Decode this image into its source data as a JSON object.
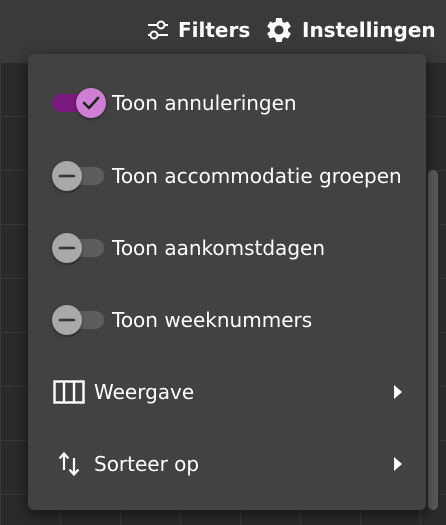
{
  "topbar": {
    "filters_label": "Filters",
    "filters_icon": "sliders-icon",
    "settings_label": "Instellingen",
    "settings_icon": "gear-icon"
  },
  "menu": {
    "toggles": [
      {
        "label": "Toon annuleringen",
        "on": true
      },
      {
        "label": "Toon accommodatie groepen",
        "on": false
      },
      {
        "label": "Toon aankomstdagen",
        "on": false
      },
      {
        "label": "Toon weeknummers",
        "on": false
      }
    ],
    "submenus": [
      {
        "label": "Weergave",
        "icon": "columns-icon"
      },
      {
        "label": "Sorteer op",
        "icon": "sort-arrows-icon"
      }
    ]
  },
  "colors": {
    "menu_bg": "#424242",
    "toggle_on_track": "#7a1a7e",
    "toggle_on_thumb": "#cf7fd3",
    "toggle_off_thumb": "#a9a9a9"
  }
}
